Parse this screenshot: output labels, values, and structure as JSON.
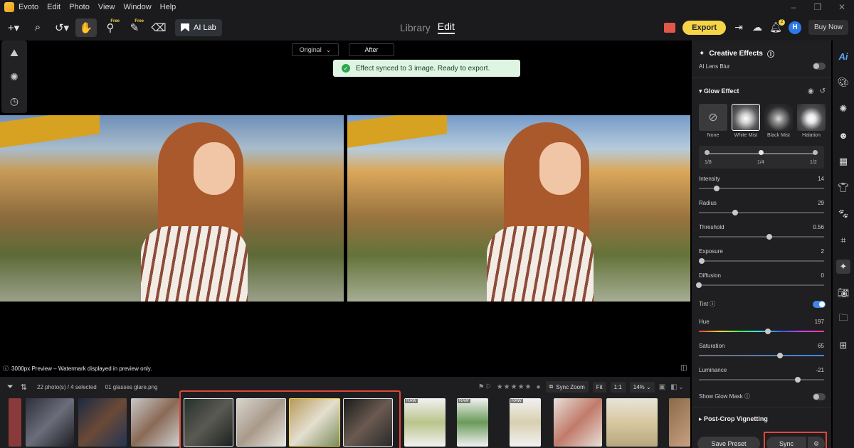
{
  "menubar": {
    "items": [
      "Evoto",
      "Edit",
      "Photo",
      "View",
      "Window",
      "Help"
    ]
  },
  "toolbar": {
    "free_tag": "Free",
    "ailab_label": "AI Lab",
    "modes": [
      "Library",
      "Edit"
    ],
    "active_mode": "Edit",
    "export_label": "Export",
    "notification_count": "2",
    "avatar_initial": "H",
    "buy_label": "Buy Now"
  },
  "canvas": {
    "compare_original": "Original",
    "compare_after": "After",
    "toast": "Effect synced to 3 image. Ready to export.",
    "preview_note": "3000px Preview – Watermark displayed in preview only."
  },
  "filmbar": {
    "info": "22 photo(s) / 4 selected",
    "current_file": "01 glasses glare.png",
    "sync_zoom": "Sync Zoom",
    "fit": "Fit",
    "ratio": "1:1",
    "zoom": "14%",
    "thumb_tags": [
      "RAW",
      "RAW",
      "RAW"
    ]
  },
  "panel": {
    "title": "Creative Effects",
    "lens_blur_label": "AI Lens Blur",
    "glow_title": "Glow Effect",
    "styles": [
      {
        "label": "None"
      },
      {
        "label": "White Mist"
      },
      {
        "label": "Black Mist"
      },
      {
        "label": "Halation"
      }
    ],
    "active_style": "White Mist",
    "levels": [
      "1/8",
      "1/4",
      "1/2"
    ],
    "active_level": "1/4",
    "sliders": {
      "intensity": {
        "label": "Intensity",
        "value": "14",
        "ratio": 0.14
      },
      "radius": {
        "label": "Radius",
        "value": "29",
        "ratio": 0.29
      },
      "threshold": {
        "label": "Threshold",
        "value": "0.56",
        "ratio": 0.56
      },
      "exposure": {
        "label": "Exposure",
        "value": "2",
        "ratio": 0.02
      },
      "diffusion": {
        "label": "Diffusion",
        "value": "0",
        "ratio": 0.0
      }
    },
    "tint_label": "Tint",
    "tint_on": true,
    "tint_sliders": {
      "hue": {
        "label": "Hue",
        "value": "197",
        "ratio": 0.55
      },
      "saturation": {
        "label": "Saturation",
        "value": "65",
        "ratio": 0.65
      },
      "luminance": {
        "label": "Luminance",
        "value": "-21",
        "ratio": 0.79
      }
    },
    "show_glow_mask": "Show Glow Mask",
    "post_crop": "Post-Crop Vignetting",
    "save_preset": "Save Preset",
    "sync": "Sync"
  },
  "colors": {
    "accent": "#f6d448",
    "toggle_on": "#3f88e8",
    "highlight": "#e0473a",
    "toast_bg": "#dff5e4"
  }
}
